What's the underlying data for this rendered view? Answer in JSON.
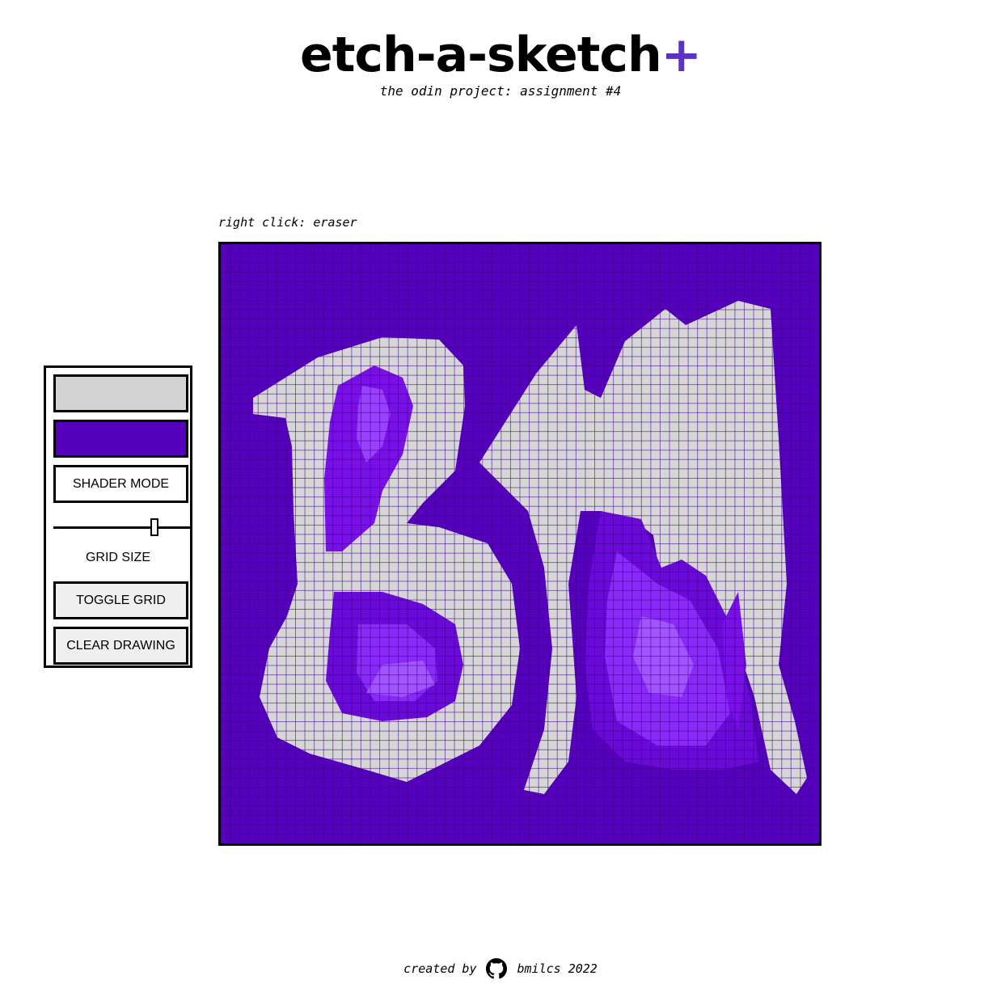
{
  "header": {
    "title": "etch-a-sketch",
    "title_plus": "+",
    "subtitle": "the odin project: assignment #4"
  },
  "canvas": {
    "hint": "right click: eraser",
    "grid_cells": 64,
    "background_color": "#5500bb",
    "grid_line_color": "#3a0088"
  },
  "controls": {
    "background_swatch": "#d3d3d3",
    "pen_swatch": "#5500bb",
    "shader_label": "SHADER MODE",
    "grid_size_label": "GRID SIZE",
    "grid_size_value": 0.75,
    "toggle_grid_label": "TOGGLE GRID",
    "clear_label": "CLEAR DRAWING"
  },
  "footer": {
    "created_by": "created by",
    "icon": "github-icon",
    "author": "bmilcs 2022"
  },
  "colors": {
    "accent": "#5b32c4",
    "drawing_light": "#d6d6d6",
    "drawing_purple": "#5500bb"
  }
}
